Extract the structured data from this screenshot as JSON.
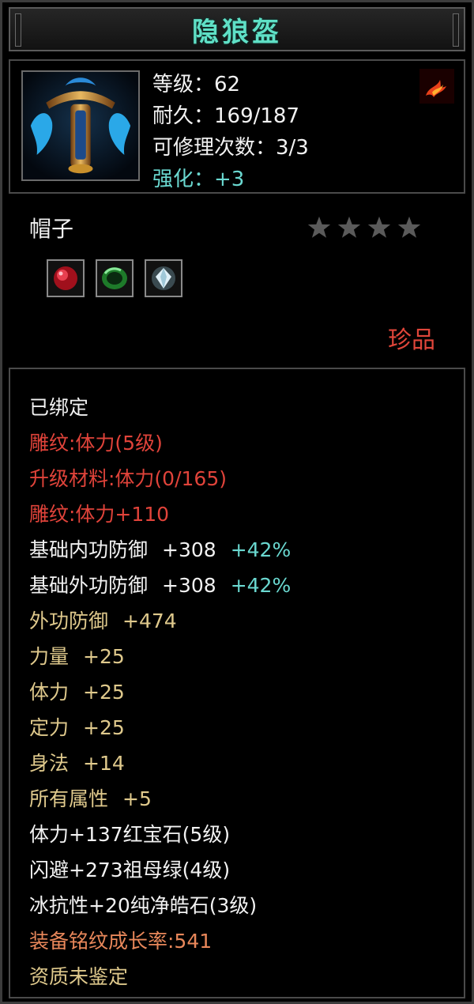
{
  "title": "隐狼盔",
  "header": {
    "level": "等级：62",
    "durability": "耐久：169/187",
    "repairs": "可修理次数：3/3",
    "enhance": "强化：+3"
  },
  "item_type": "帽子",
  "stars": {
    "total": 4,
    "filled": 0
  },
  "gems": [
    {
      "name": "ruby-gem-icon",
      "color": "#c8202a"
    },
    {
      "name": "emerald-gem-icon",
      "color": "#2e9a3a"
    },
    {
      "name": "diamond-gem-icon",
      "color": "#d8e8f0"
    }
  ],
  "quality": "珍品",
  "attributes": {
    "bound": "已绑定",
    "engrave": "雕纹:体力(5级)",
    "upgrade_material": "升级材料:体力(0/165)",
    "engrave_bonus": "雕纹:体力+110",
    "base_inner_def": {
      "label": "基础内功防御",
      "value": "+308",
      "pct": "+42%"
    },
    "base_outer_def": {
      "label": "基础外功防御",
      "value": "+308",
      "pct": "+42%"
    },
    "outer_def": {
      "label": "外功防御",
      "value": "+474"
    },
    "strength": {
      "label": "力量",
      "value": "+25"
    },
    "stamina": {
      "label": "体力",
      "value": "+25"
    },
    "focus": {
      "label": "定力",
      "value": "+25"
    },
    "agility": {
      "label": "身法",
      "value": "+14"
    },
    "all_stats": {
      "label": "所有属性",
      "value": "+5"
    },
    "gem_ruby": "体力+137红宝石(5级)",
    "gem_emerald": "闪避+273祖母绿(4级)",
    "gem_diamond": "冰抗性+20纯净皓石(3级)",
    "growth_rate": "装备铭纹成长率:541",
    "aptitude": "资质未鉴定"
  },
  "colors": {
    "title": "#5fe0c6",
    "red": "#e0433a",
    "gold": "#dfc98c",
    "cyan": "#6ad8d0",
    "orange": "#e8875a",
    "star_inactive": "#5a5a5a"
  }
}
